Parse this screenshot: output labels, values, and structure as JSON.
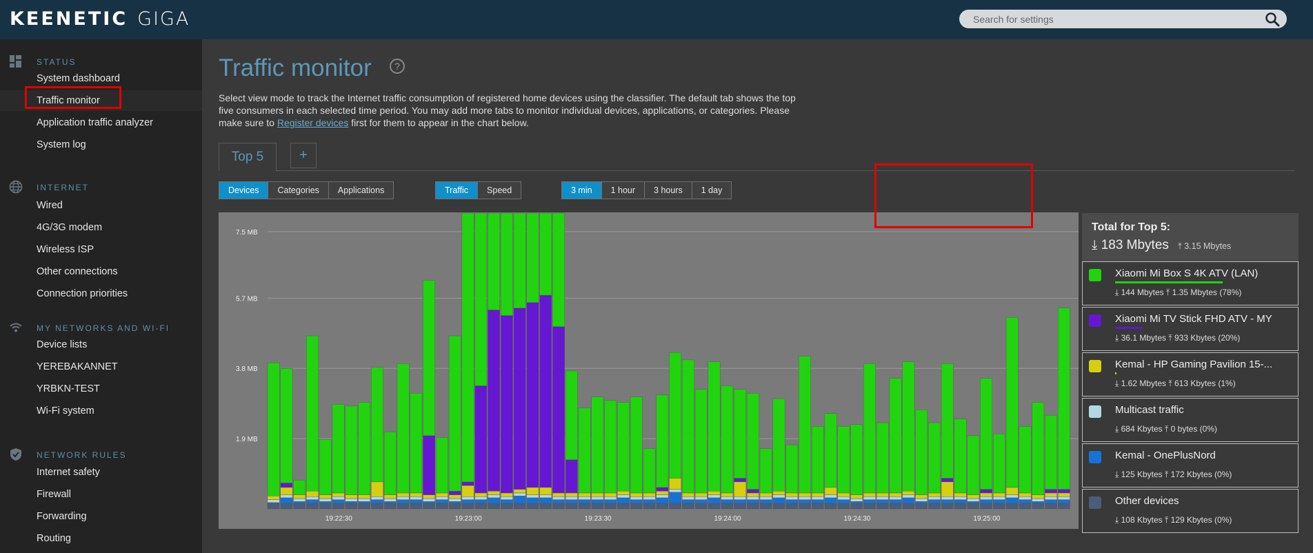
{
  "topbar": {
    "brand": "KEENETIC",
    "model": "GIGA",
    "search_placeholder": "Search for settings"
  },
  "sidebar": {
    "sections": [
      {
        "title": "STATUS",
        "icon": "dashboard-icon",
        "items": [
          "System dashboard",
          "Traffic monitor",
          "Application traffic analyzer",
          "System log"
        ]
      },
      {
        "title": "INTERNET",
        "icon": "globe-icon",
        "items": [
          "Wired",
          "4G/3G modem",
          "Wireless ISP",
          "Other connections",
          "Connection priorities"
        ]
      },
      {
        "title": "MY NETWORKS AND WI-FI",
        "icon": "wifi-icon",
        "items": [
          "Device lists",
          "YEREBAKANNET",
          "YRBKN-TEST",
          "Wi-Fi system"
        ]
      },
      {
        "title": "NETWORK RULES",
        "icon": "shield-icon",
        "items": [
          "Internet safety",
          "Firewall",
          "Forwarding",
          "Routing"
        ]
      }
    ],
    "active_item": "Traffic monitor"
  },
  "page": {
    "title": "Traffic monitor",
    "help_icon": "question-icon",
    "desc_1": "Select view mode to track the Internet traffic consumption of registered home devices using the classifier. The default tab shows the top five consumers in each selected time period. You may add more tabs to monitor individual devices, applications, or categories. Please make sure to ",
    "desc_link": "Register devices",
    "desc_2": " first for them to appear in the chart below."
  },
  "tabs": {
    "top5": "Top 5",
    "add": "+"
  },
  "view_mode": {
    "options": [
      "Devices",
      "Categories",
      "Applications"
    ],
    "selected": "Devices"
  },
  "metric": {
    "options": [
      "Traffic",
      "Speed"
    ],
    "selected": "Traffic"
  },
  "period": {
    "options": [
      "3 min",
      "1 hour",
      "3 hours",
      "1 day"
    ],
    "selected": "3 min"
  },
  "colors": {
    "green": "#21d40f",
    "purple": "#6517d1",
    "yellow": "#d6cf0f",
    "lightblue": "#b3d8e4",
    "blue": "#1672d6",
    "other": "#4b5d78",
    "accent": "#118fc9"
  },
  "totals": {
    "title": "Total for Top 5:",
    "down": "183 Mbytes",
    "up": "3.15 Mbytes"
  },
  "legend": [
    {
      "name": "Xiaomi Mi Box S 4K ATV (LAN)",
      "down": "144 Mbytes",
      "up": "1.35 Mbytes",
      "pct": "(78%)",
      "share": 0.78,
      "color": "#21d40f"
    },
    {
      "name": "Xiaomi Mi TV Stick FHD ATV - MY",
      "down": "36.1 Mbytes",
      "up": "933 Kbytes",
      "pct": "(20%)",
      "share": 0.2,
      "color": "#6517d1"
    },
    {
      "name": "Kemal - HP Gaming Pavilion 15-...",
      "down": "1.62 Mbytes",
      "up": "613 Kbytes",
      "pct": "(1%)",
      "share": 0.01,
      "color": "#d6cf0f"
    },
    {
      "name": "Multicast traffic",
      "down": "684 Kbytes",
      "up": "0 bytes",
      "pct": "(0%)",
      "share": 0.0,
      "color": "#b3d8e4"
    },
    {
      "name": "Kemal - OnePlusNord",
      "down": "125 Kbytes",
      "up": "172 Kbytes",
      "pct": "(0%)",
      "share": 0.0,
      "color": "#1672d6"
    },
    {
      "name": "Other devices",
      "down": "108 Kbytes",
      "up": "129 Kbytes",
      "pct": "(0%)",
      "share": 0.0,
      "color": "#4b5d78"
    }
  ],
  "chart_data": {
    "type": "bar",
    "stacked": true,
    "ylim": [
      0,
      8.0
    ],
    "y_ticks": [
      "1.9 MB",
      "3.8 MB",
      "5.7 MB",
      "7.5 MB"
    ],
    "y_tick_values": [
      1.9,
      3.8,
      5.7,
      7.5
    ],
    "x_tick_labels": [
      "19:22:30",
      "19:23:00",
      "19:23:30",
      "19:24:00",
      "19:24:30",
      "19:25:00"
    ],
    "x_tick_index": [
      5,
      15,
      25,
      35,
      45,
      55
    ],
    "grid": true,
    "series": [
      {
        "name": "Xiaomi Mi Box S 4K ATV (LAN)",
        "color": "#21d40f",
        "values": [
          3.6,
          3.1,
          0.4,
          4.2,
          1.5,
          2.4,
          2.4,
          2.5,
          3.1,
          1.7,
          3.5,
          2.7,
          4.2,
          1.5,
          4.2,
          7.3,
          7.8,
          5.0,
          5.1,
          5.0,
          5.1,
          5.4,
          5.3,
          2.4,
          2.3,
          2.6,
          2.5,
          2.4,
          2.6,
          1.2,
          2.5,
          3.4,
          3.6,
          2.8,
          3.5,
          2.9,
          2.4,
          2.6,
          1.2,
          2.5,
          1.3,
          3.7,
          1.8,
          2.0,
          1.8,
          1.9,
          3.5,
          1.9,
          3.1,
          3.5,
          2.3,
          1.9,
          3.1,
          2.0,
          1.6,
          3.0,
          1.6,
          4.6,
          1.8,
          2.5,
          2.0,
          4.9
        ]
      },
      {
        "name": "Xiaomi Mi TV Stick FHD ATV - MY",
        "color": "#6517d1",
        "values": [
          0,
          0.12,
          0,
          0,
          0,
          0,
          0,
          0,
          0,
          0,
          0,
          0,
          1.6,
          0,
          0.1,
          0.1,
          2.9,
          4.9,
          4.8,
          4.9,
          5.0,
          5.2,
          4.5,
          0.9,
          0,
          0,
          0,
          0,
          0,
          0,
          0.1,
          0,
          0,
          0,
          0,
          0,
          0.1,
          0.1,
          0,
          0,
          0,
          0,
          0,
          0,
          0,
          0,
          0,
          0,
          0,
          0,
          0,
          0,
          0.1,
          0,
          0,
          0.1,
          0,
          0,
          0,
          0,
          0.1,
          0.1
        ]
      },
      {
        "name": "Kemal - HP Gaming Pavilion 15-...",
        "color": "#d6cf0f",
        "values": [
          0.1,
          0.2,
          0.1,
          0.15,
          0.1,
          0.1,
          0.1,
          0.1,
          0.4,
          0.1,
          0.1,
          0.1,
          0.1,
          0.1,
          0.1,
          0.3,
          0.1,
          0.1,
          0.1,
          0.1,
          0.2,
          0.2,
          0.1,
          0.1,
          0.1,
          0.1,
          0.1,
          0.1,
          0.1,
          0.1,
          0.1,
          0.3,
          0.1,
          0.1,
          0.1,
          0.1,
          0.4,
          0.1,
          0.1,
          0.1,
          0.1,
          0.1,
          0.1,
          0.2,
          0.1,
          0.1,
          0.1,
          0.1,
          0.1,
          0.1,
          0.1,
          0.1,
          0.4,
          0.1,
          0.1,
          0.1,
          0.1,
          0.2,
          0.1,
          0.1,
          0.1,
          0.1
        ]
      },
      {
        "name": "Multicast traffic",
        "color": "#b3d8e4",
        "values": [
          0.08,
          0.08,
          0.08,
          0.08,
          0.08,
          0.08,
          0.08,
          0.08,
          0.08,
          0.08,
          0.08,
          0.08,
          0.08,
          0.08,
          0.08,
          0.08,
          0.08,
          0.08,
          0.08,
          0.08,
          0.08,
          0.08,
          0.08,
          0.08,
          0.08,
          0.08,
          0.08,
          0.08,
          0.08,
          0.08,
          0.08,
          0.08,
          0.08,
          0.08,
          0.08,
          0.08,
          0.08,
          0.08,
          0.08,
          0.08,
          0.08,
          0.08,
          0.08,
          0.08,
          0.08,
          0.08,
          0.08,
          0.08,
          0.08,
          0.08,
          0.08,
          0.08,
          0.08,
          0.08,
          0.08,
          0.08,
          0.08,
          0.08,
          0.08,
          0.08,
          0.08,
          0.08
        ]
      },
      {
        "name": "Kemal - OnePlusNord",
        "color": "#1672d6",
        "values": [
          0.02,
          0.15,
          0.05,
          0.1,
          0.05,
          0.1,
          0.05,
          0.05,
          0.1,
          0.05,
          0.1,
          0.1,
          0.05,
          0.1,
          0.05,
          0.1,
          0.1,
          0.15,
          0.1,
          0.2,
          0.15,
          0.15,
          0.1,
          0.1,
          0.1,
          0.1,
          0.1,
          0.15,
          0.1,
          0.1,
          0.15,
          0.3,
          0.1,
          0.1,
          0.15,
          0.1,
          0.1,
          0.1,
          0.1,
          0.15,
          0.1,
          0.1,
          0.1,
          0.15,
          0.1,
          0.05,
          0.1,
          0.1,
          0.1,
          0.15,
          0.05,
          0.1,
          0.1,
          0.1,
          0.05,
          0.1,
          0.1,
          0.15,
          0.1,
          0.05,
          0.1,
          0.1
        ]
      },
      {
        "name": "Other devices",
        "color": "#4b5d78",
        "values": [
          0.15,
          0.15,
          0.15,
          0.15,
          0.15,
          0.15,
          0.15,
          0.15,
          0.15,
          0.15,
          0.15,
          0.15,
          0.15,
          0.15,
          0.15,
          0.15,
          0.15,
          0.15,
          0.15,
          0.15,
          0.15,
          0.15,
          0.15,
          0.15,
          0.15,
          0.15,
          0.15,
          0.15,
          0.15,
          0.15,
          0.15,
          0.15,
          0.15,
          0.15,
          0.15,
          0.15,
          0.15,
          0.15,
          0.15,
          0.15,
          0.15,
          0.15,
          0.15,
          0.15,
          0.15,
          0.15,
          0.15,
          0.15,
          0.15,
          0.15,
          0.15,
          0.15,
          0.15,
          0.15,
          0.15,
          0.15,
          0.15,
          0.15,
          0.15,
          0.15,
          0.15,
          0.15
        ]
      }
    ]
  }
}
